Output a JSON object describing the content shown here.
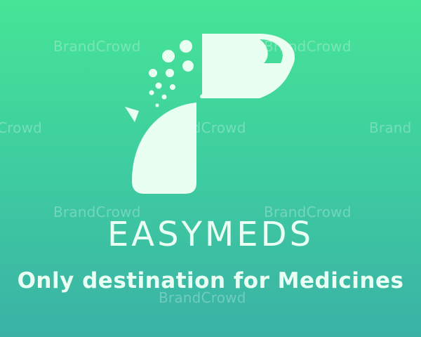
{
  "brand": {
    "name": "EASYMEDS",
    "tagline": "Only destination for Medicines"
  },
  "watermark": {
    "text": "BrandCrowd",
    "partial_text": "Crowd",
    "partial_text_right": "Brand"
  },
  "colors": {
    "background_top": "#46e496",
    "background_bottom": "#3ab2a6",
    "logo_fill": "#e8fff2"
  },
  "logo": {
    "icon": "pill-letter-p-icon"
  }
}
